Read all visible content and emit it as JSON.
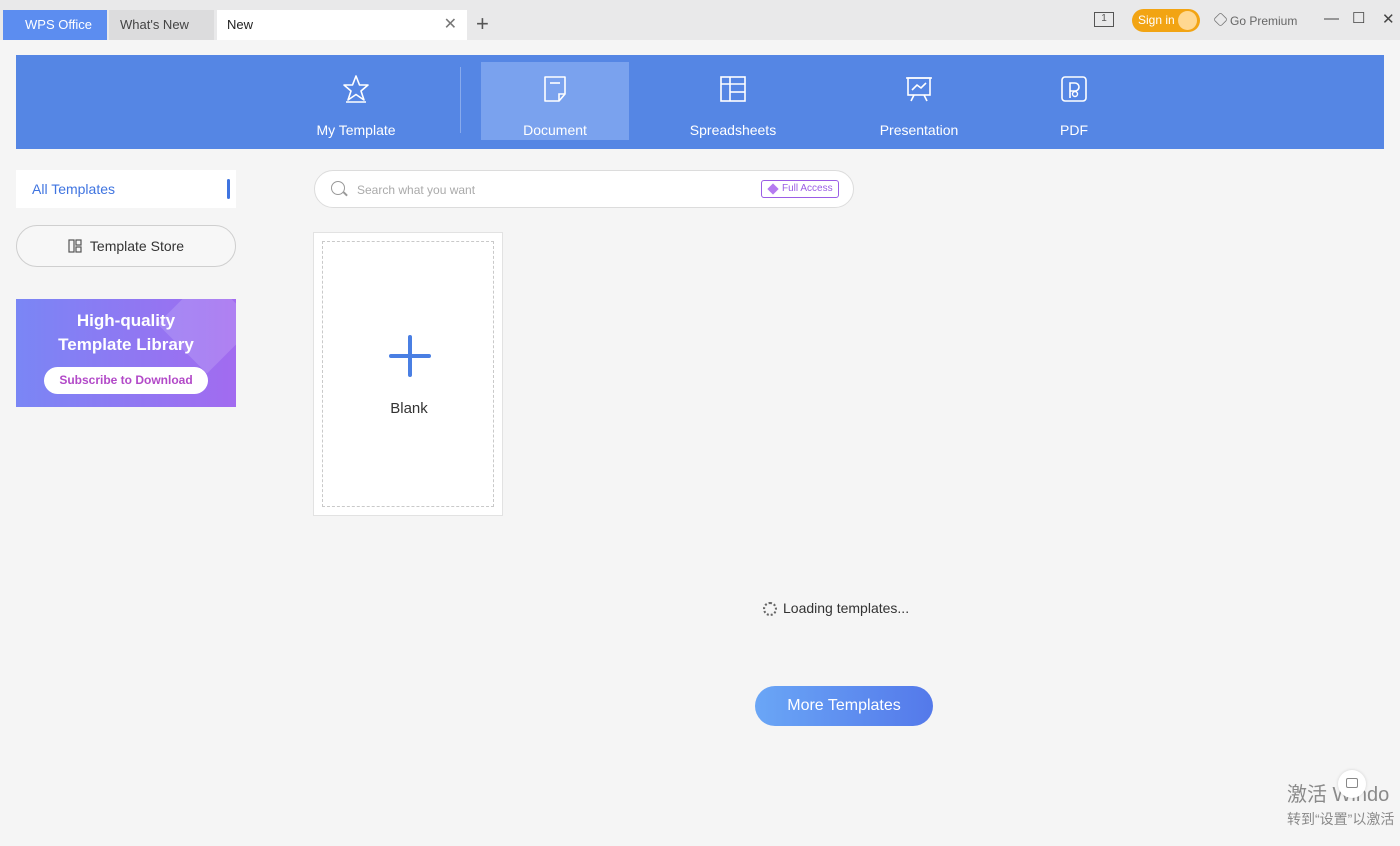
{
  "tabs": [
    {
      "label": "WPS Office"
    },
    {
      "label": "What's New"
    },
    {
      "label": "New"
    }
  ],
  "topbar": {
    "window_count": "1",
    "sign_in_label": "Sign in",
    "premium_label": "Go Premium"
  },
  "categories": [
    {
      "label": "My Template",
      "icon": "star-icon"
    },
    {
      "label": "Document",
      "icon": "document-icon",
      "active": true
    },
    {
      "label": "Spreadsheets",
      "icon": "spreadsheet-icon"
    },
    {
      "label": "Presentation",
      "icon": "presentation-icon"
    },
    {
      "label": "PDF",
      "icon": "pdf-icon"
    }
  ],
  "sidebar": {
    "all_templates": "All Templates",
    "template_store": "Template Store",
    "promo": {
      "line1": "High-quality",
      "line2": "Template Library",
      "button": "Subscribe to Download"
    }
  },
  "search": {
    "placeholder": "Search what you want",
    "badge": "Full Access"
  },
  "blank": {
    "label": "Blank"
  },
  "loading_text": "Loading templates...",
  "more_button": "More Templates",
  "activation": {
    "line1": "激活 Windo",
    "line2": "转到“设置”以激活"
  },
  "colors": {
    "header_blue": "#5586e4",
    "accent_blue": "#3f74e0",
    "signin_orange": "#f2a413",
    "promo_purple": "#a26bf0"
  }
}
